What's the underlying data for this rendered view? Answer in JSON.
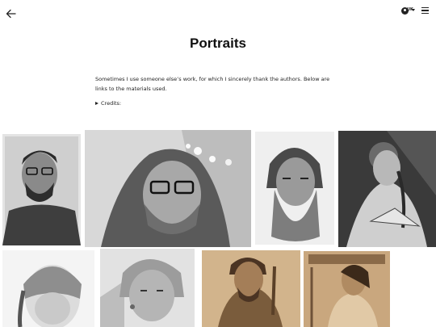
{
  "header": {
    "back_icon": "arrow-left-icon",
    "language_code": "UK",
    "language_icon": "globe-icon",
    "menu_icon": "hamburger-menu-icon"
  },
  "page": {
    "title": "Portraits",
    "intro": "Sometimes I use someone else’s work, for which I sincerely thank the authors. Below are links to the materials used.",
    "credits_label": "Credits:"
  },
  "gallery": {
    "tiles": [
      {
        "subject": "man-with-glasses-and-beard"
      },
      {
        "subject": "bearded-man-in-hood-with-glasses"
      },
      {
        "subject": "old-man-with-long-beard"
      },
      {
        "subject": "woman-with-braid-sewing"
      },
      {
        "subject": "girl-with-bangs"
      },
      {
        "subject": "older-woman-short-hair"
      },
      {
        "subject": "man-with-beard-sepia"
      },
      {
        "subject": "woman-in-profile-sepia"
      }
    ]
  }
}
